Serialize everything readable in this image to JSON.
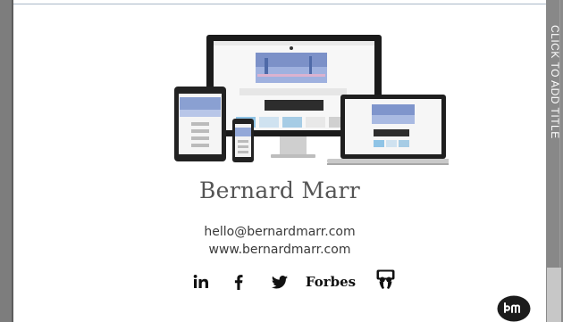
{
  "sidebar": {
    "panel_label": "CLICK TO ADD TITLE"
  },
  "slide": {
    "name": "Bernard Marr",
    "email": "hello@bernardmarr.com",
    "website": "www.bernardmarr.com",
    "social": {
      "linkedin": "in",
      "forbes": "Forbes"
    },
    "logo_text": "bm"
  },
  "colors": {
    "side_bar": "#7d7d7d",
    "name_text": "#555555",
    "logo_bg": "#1c1c1c"
  }
}
